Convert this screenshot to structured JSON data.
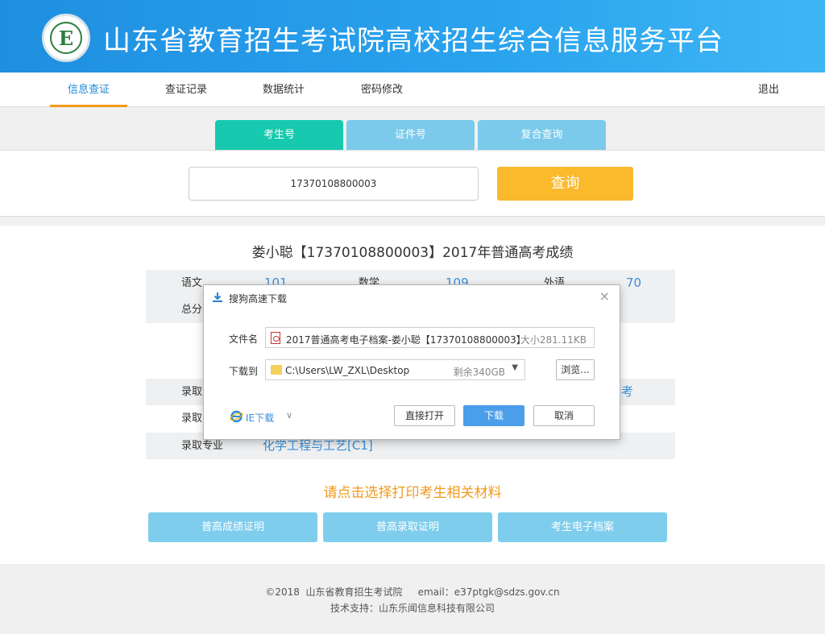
{
  "header": {
    "logo_letter": "E",
    "title": "山东省教育招生考试院高校招生综合信息服务平台"
  },
  "nav": {
    "items": [
      {
        "label": "信息查证",
        "active": true
      },
      {
        "label": "查证记录"
      },
      {
        "label": "数据统计"
      },
      {
        "label": "密码修改"
      }
    ],
    "logout": "退出"
  },
  "search": {
    "tabs": [
      {
        "label": "考生号",
        "active": true
      },
      {
        "label": "证件号"
      },
      {
        "label": "复合查询"
      }
    ],
    "input_value": "17370108800003",
    "button_label": "查询"
  },
  "result": {
    "title": "娄小聪【17370108800003】2017年普通高考成绩",
    "scores": [
      {
        "label": "语文",
        "value": "101"
      },
      {
        "label": "数学",
        "value": "109"
      },
      {
        "label": "外语",
        "value": "70"
      }
    ],
    "total_label": "总分",
    "admission": [
      {
        "label": "录取",
        "value": "考"
      },
      {
        "label": "录取",
        "value": ""
      },
      {
        "label": "录取专业",
        "value": "化学工程与工艺[C1]"
      }
    ],
    "print_hint": "请点击选择打印考生相关材料",
    "print_buttons": [
      "普高成绩证明",
      "普高录取证明",
      "考生电子档案"
    ]
  },
  "footer": {
    "line1": "©2018  山东省教育招生考试院     email：e37ptgk@sdzs.gov.cn",
    "line2": "技术支持：山东乐闻信息科技有限公司"
  },
  "dialog": {
    "title": "搜狗高速下载",
    "file_label": "文件名",
    "file_name": "2017普通高考电子档案-娄小聪【17370108800003】.",
    "file_size": "大小281.11KB",
    "path_label": "下载到",
    "path": "C:\\Users\\LW_ZXL\\Desktop",
    "free_space": "剩余340GB",
    "browse": "浏览...",
    "ie_download": "IE下载",
    "open_direct": "直接打开",
    "download": "下载",
    "cancel": "取消",
    "close_icon": "×",
    "dropdown_arrow": "▼",
    "chevron": "∨"
  },
  "colors": {
    "banner": "#2aa3ee",
    "tab_active": "#17c9ae",
    "tab_normal": "#7bcaeb",
    "search_button": "#fbb92c",
    "link_blue": "#3b8fd9",
    "orange": "#f19a1b",
    "dialog_primary": "#4b9eea"
  }
}
